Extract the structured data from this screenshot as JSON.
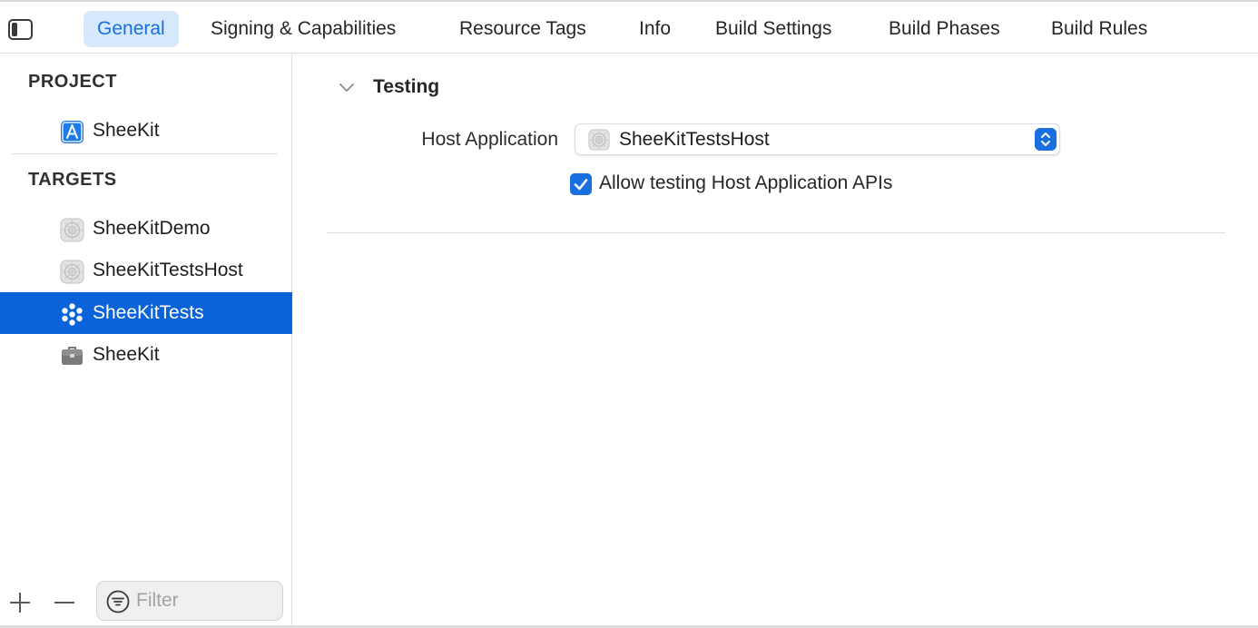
{
  "tabs": [
    {
      "label": "General",
      "active": true
    },
    {
      "label": "Signing & Capabilities",
      "active": false
    },
    {
      "label": "Resource Tags",
      "active": false
    },
    {
      "label": "Info",
      "active": false
    },
    {
      "label": "Build Settings",
      "active": false
    },
    {
      "label": "Build Phases",
      "active": false
    },
    {
      "label": "Build Rules",
      "active": false
    }
  ],
  "sidebar": {
    "project_header": "PROJECT",
    "project_items": [
      {
        "label": "SheeKit",
        "icon": "xcode-project-icon"
      }
    ],
    "targets_header": "TARGETS",
    "target_items": [
      {
        "label": "SheeKitDemo",
        "icon": "app-target-icon",
        "selected": false
      },
      {
        "label": "SheeKitTestsHost",
        "icon": "app-target-icon",
        "selected": false
      },
      {
        "label": "SheeKitTests",
        "icon": "unit-test-target-icon",
        "selected": true
      },
      {
        "label": "SheeKit",
        "icon": "framework-target-icon",
        "selected": false
      }
    ],
    "filter_placeholder": "Filter"
  },
  "main": {
    "section_title": "Testing",
    "host_application_label": "Host Application",
    "host_application_value": "SheeKitTestsHost",
    "allow_testing_label": "Allow testing Host Application APIs",
    "allow_testing_checked": true
  },
  "colors": {
    "accent": "#1a6fe0",
    "selection": "#0b62d9",
    "active_tab_bg": "#d6e8fb"
  }
}
